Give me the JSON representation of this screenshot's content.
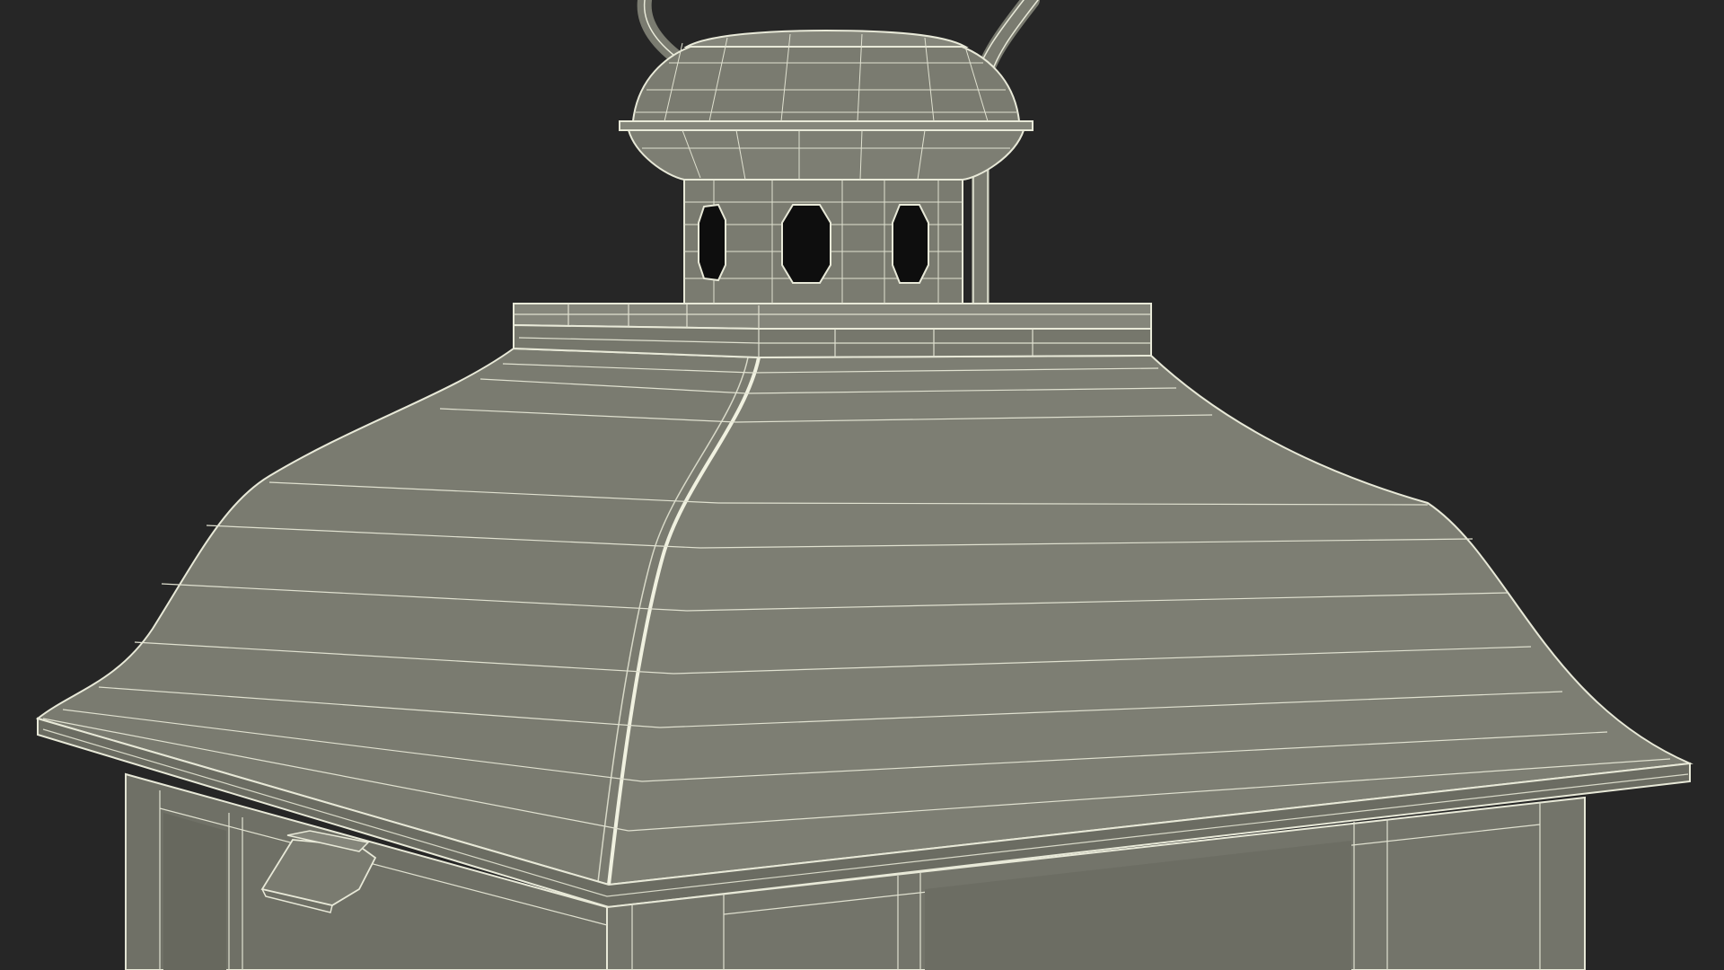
{
  "scene": {
    "subject": "lantern-wireframe-render",
    "colors": {
      "background": "#262626",
      "surface": "#7a7b70",
      "surface_dark": "#6b6c62",
      "surface_light": "#85867b",
      "wire": "#e8e9d8",
      "wire_dim": "#cfd0bf",
      "hole": "#0e0e0e"
    }
  }
}
